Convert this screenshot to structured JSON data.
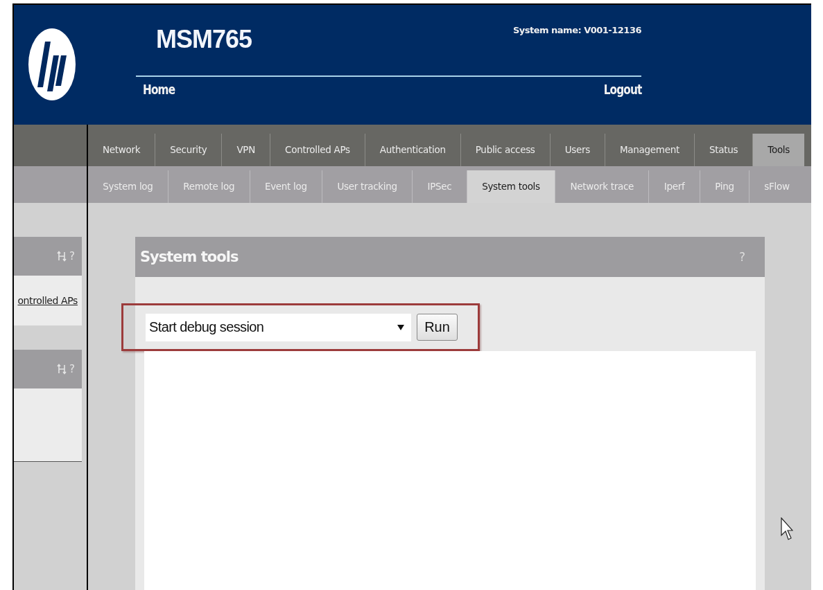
{
  "header": {
    "title": "MSM765",
    "system_name": "System name: V001-12136",
    "links": [
      {
        "label": "Home"
      },
      {
        "label": "Logout"
      }
    ]
  },
  "main_tabs": [
    {
      "label": "Network",
      "selected": false
    },
    {
      "label": "Security",
      "selected": false
    },
    {
      "label": "VPN",
      "selected": false
    },
    {
      "label": "Controlled APs",
      "selected": false
    },
    {
      "label": "Authentication",
      "selected": false
    },
    {
      "label": "Public access",
      "selected": false
    },
    {
      "label": "Users",
      "selected": false
    },
    {
      "label": "Management",
      "selected": false
    },
    {
      "label": "Status",
      "selected": false
    },
    {
      "label": "Tools",
      "selected": true
    }
  ],
  "sub_tabs": [
    {
      "label": "System log",
      "selected": false
    },
    {
      "label": "Remote log",
      "selected": false
    },
    {
      "label": "Event log",
      "selected": false
    },
    {
      "label": "User tracking",
      "selected": false
    },
    {
      "label": "IPSec",
      "selected": false
    },
    {
      "label": "System tools",
      "selected": true
    },
    {
      "label": "Network trace",
      "selected": false
    },
    {
      "label": "Iperf",
      "selected": false
    },
    {
      "label": "Ping",
      "selected": false
    },
    {
      "label": "sFlow",
      "selected": false
    }
  ],
  "sidebar": {
    "panels": [
      {
        "help": "?",
        "link": "ontrolled APs"
      },
      {
        "help": "?"
      }
    ]
  },
  "panel": {
    "title": "System tools",
    "help": "?",
    "tool_select": {
      "value": "Start debug session"
    },
    "run_button": "Run",
    "highlighted": true
  }
}
